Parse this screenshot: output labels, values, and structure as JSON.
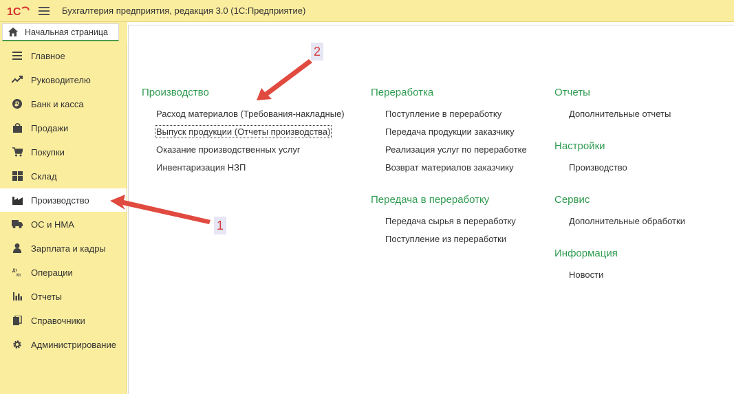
{
  "app": {
    "title": "Бухгалтерия предприятия, редакция 3.0  (1С:Предприятие)",
    "logo_icon": "1c-logo-icon",
    "accent_color": "#fbed9e",
    "section_color": "#2e9b4f"
  },
  "tabs": {
    "home_label": "Начальная страница"
  },
  "sidebar": {
    "items": [
      {
        "label": "Главное",
        "icon": "list-icon"
      },
      {
        "label": "Руководителю",
        "icon": "trend-icon"
      },
      {
        "label": "Банк и касса",
        "icon": "ruble-coin-icon"
      },
      {
        "label": "Продажи",
        "icon": "shopping-bag-icon"
      },
      {
        "label": "Покупки",
        "icon": "cart-icon"
      },
      {
        "label": "Склад",
        "icon": "warehouse-icon"
      },
      {
        "label": "Производство",
        "icon": "factory-icon"
      },
      {
        "label": "ОС и НМА",
        "icon": "truck-icon"
      },
      {
        "label": "Зарплата и кадры",
        "icon": "person-icon"
      },
      {
        "label": "Операции",
        "icon": "debit-credit-icon"
      },
      {
        "label": "Отчеты",
        "icon": "bar-chart-icon"
      },
      {
        "label": "Справочники",
        "icon": "books-icon"
      },
      {
        "label": "Администрирование",
        "icon": "gear-icon"
      }
    ],
    "active_index": 6
  },
  "main": {
    "col1": {
      "title": "Производство",
      "links": [
        "Расход материалов (Требования-накладные)",
        "Выпуск продукции (Отчеты производства)",
        "Оказание производственных услуг",
        "Инвентаризация НЗП"
      ]
    },
    "col2": {
      "title": "Переработка",
      "links": [
        "Поступление в переработку",
        "Передача продукции заказчику",
        "Реализация услуг по переработке",
        "Возврат материалов заказчику"
      ],
      "title2": "Передача в переработку",
      "links2": [
        "Передача сырья в переработку",
        "Поступление из переработки"
      ]
    },
    "col3": {
      "reports_title": "Отчеты",
      "reports_links": [
        "Дополнительные отчеты"
      ],
      "settings_title": "Настройки",
      "settings_links": [
        "Производство"
      ],
      "service_title": "Сервис",
      "service_links": [
        "Дополнительные обработки"
      ],
      "info_title": "Информация",
      "info_links": [
        "Новости"
      ]
    }
  },
  "annotations": {
    "badge1": "1",
    "badge2": "2",
    "arrow_color": "#e04a3f"
  }
}
